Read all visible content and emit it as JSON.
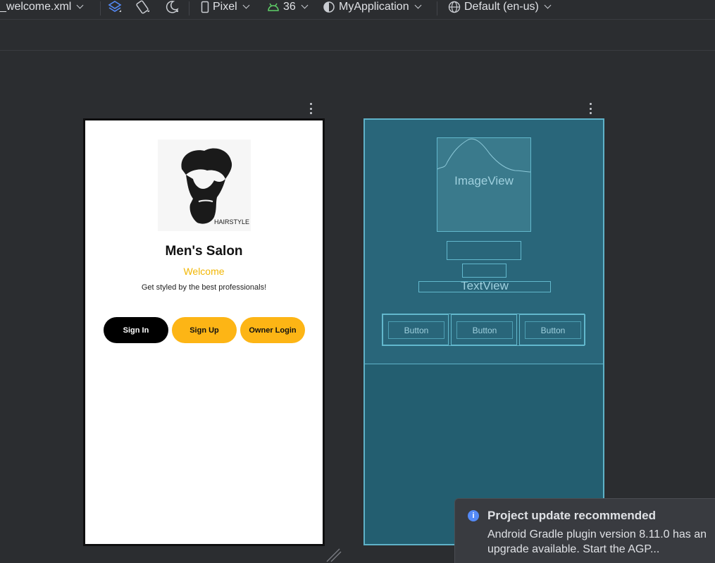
{
  "toolbar": {
    "layout_file": "_welcome.xml",
    "device": "Pixel",
    "api_level": "36",
    "theme": "MyApplication",
    "locale": "Default (en-us)"
  },
  "design_preview": {
    "logo_text": "HAIRSTYLE",
    "title": "Men's Salon",
    "welcome": "Welcome",
    "tagline": "Get styled by the best professionals!",
    "buttons": {
      "sign_in": "Sign In",
      "sign_up": "Sign Up",
      "owner_login": "Owner Login"
    }
  },
  "blueprint_preview": {
    "image_label": "ImageView",
    "text_label": "TextView",
    "buttons": [
      "Button",
      "Button",
      "Button"
    ]
  },
  "notification": {
    "title": "Project update recommended",
    "body": "Android Gradle plugin version 8.11.0 has an upgrade available. Start the AGP..."
  },
  "colors": {
    "accent_yellow": "#fdb515",
    "blueprint_bg": "#235e70",
    "notify_icon": "#548af7"
  }
}
